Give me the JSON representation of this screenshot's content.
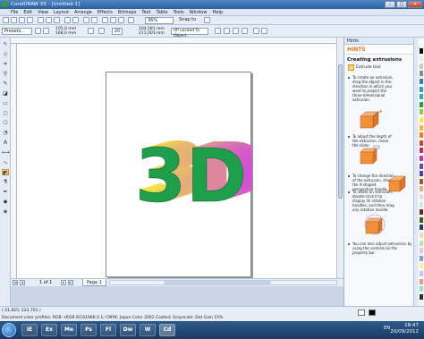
{
  "window": {
    "title": "CorelDRAW X5 - [Untitled-1]",
    "min": "–",
    "max": "□",
    "close": "✕"
  },
  "menu": [
    "File",
    "Edit",
    "View",
    "Layout",
    "Arrange",
    "Effects",
    "Bitmaps",
    "Text",
    "Table",
    "Tools",
    "Window",
    "Help"
  ],
  "toolbar": {
    "zoom": "36%",
    "snap": "Snap to"
  },
  "propbar": {
    "preset": "Presets...",
    "x": "105,0 mm",
    "y": "168,0 mm",
    "depth": "20",
    "vp_x": "104,581 mm",
    "vp_y": "211,003 mm",
    "vp_lock": "VP Locked To Object"
  },
  "tools": [
    "pick-tool",
    "shape-tool",
    "crop-tool",
    "zoom-tool",
    "freehand-tool",
    "smart-fill-tool",
    "rectangle-tool",
    "ellipse-tool",
    "polygon-tool",
    "basic-shapes-tool",
    "text-tool",
    "parallel-dimension-tool",
    "connector-tool",
    "blend-tool",
    "extrude-tool",
    "eyedropper-tool",
    "outline-tool",
    "fill-tool",
    "interactive-fill-tool"
  ],
  "artwork": {
    "text": "3D",
    "front_color": "#1f9e4b",
    "side_start": "#f2ef3a",
    "side_end": "#d14ad8"
  },
  "pagebar": {
    "count": "1 of 1",
    "tab": "Page 1"
  },
  "hints": {
    "panel_label": "Hints",
    "band": "HINTS",
    "title": "Creating extrusions",
    "tool": "Extrude tool",
    "steps": [
      "To create an extrusion, drag the object in the direction in which you want to project the three-dimensional extrusion.",
      "To adjust the depth of the extrusion, move the slider.",
      "To change the direction of the extrusion, drag the X-shaped perspective handle.",
      "To rotate an extrusion, double-click it to display its rotation handles, and then drag any rotation handle.",
      "You can also adjust extrusions by using the controls on the property bar."
    ]
  },
  "palette": [
    "#ffffff",
    "#000000",
    "#e9e9e9",
    "#c8c8c8",
    "#8a8a8a",
    "#2a7ad1",
    "#1ea3d6",
    "#27b3a6",
    "#1f9e4b",
    "#8fcf3c",
    "#f2ef3a",
    "#f7b52a",
    "#f07c1f",
    "#e23d2a",
    "#d1275e",
    "#c13aa5",
    "#7b3fb8",
    "#4a3fb0",
    "#a45a2a",
    "#d8b38a",
    "#f5d0d8",
    "#c9e8f5",
    "#7d1f1f",
    "#3d5a1f",
    "#1f3d6b",
    "#ffd5a8",
    "#b8e6b0",
    "#e8c0f0",
    "#7aa0d8",
    "#f0f0a0",
    "#c0c0ff",
    "#ff9090",
    "#90e0e0",
    "#2a2a2a"
  ],
  "status": {
    "coords": "( 41,825; 222,701 )",
    "profile": "Document color profiles: RGB: sRGB IEC61966-2.1; CMYK: Japan Color 2001 Coated; Grayscale: Dot Gain 15%"
  },
  "taskbar": {
    "apps": [
      "IE",
      "Ex",
      "Me",
      "Ps",
      "Fl",
      "Dw",
      "W",
      "Cd"
    ],
    "tray": "EN",
    "time": "18:47",
    "date": "20/09/2012"
  }
}
